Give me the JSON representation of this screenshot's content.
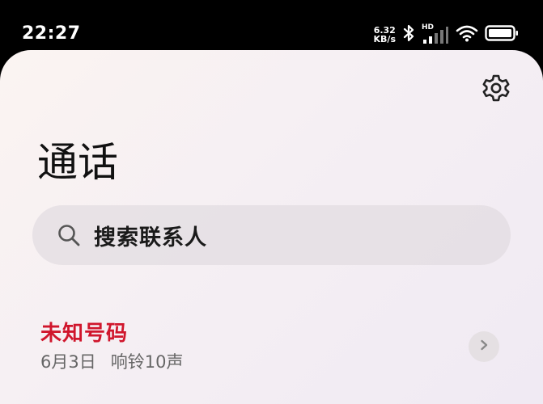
{
  "status_bar": {
    "time": "22:27",
    "net_speed_value": "6.32",
    "net_speed_unit": "KB/s",
    "hd_label": "HD",
    "icons": [
      "bluetooth-icon",
      "signal-icon",
      "wifi-icon",
      "battery-icon"
    ]
  },
  "header": {
    "title": "通话",
    "settings_icon": "gear-icon"
  },
  "search": {
    "placeholder": "搜索联系人",
    "icon": "search-icon"
  },
  "calls": [
    {
      "name": "未知号码",
      "date": "6月3日",
      "ring_info": "响铃10声",
      "status_color": "#d0162c"
    }
  ],
  "colors": {
    "missed_call": "#d0162c",
    "title": "#111111",
    "secondary_text": "#666666"
  }
}
